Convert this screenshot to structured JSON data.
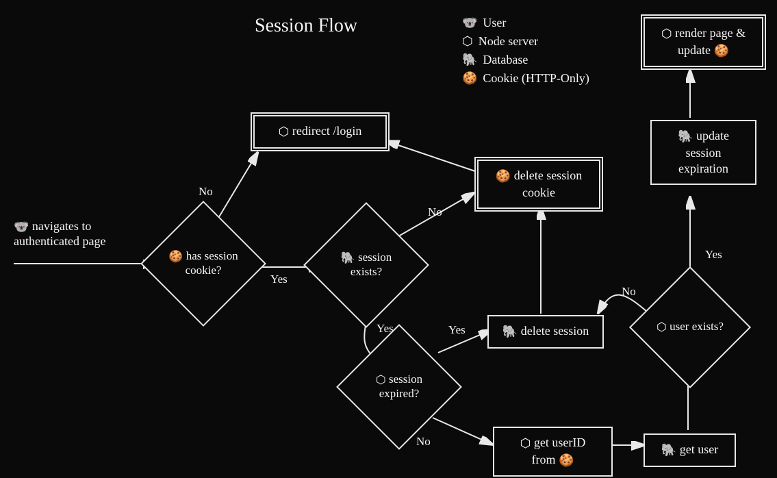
{
  "title": "Session Flow",
  "legend": {
    "user": "User",
    "node": "Node server",
    "db": "Database",
    "cookie": "Cookie (HTTP-Only)"
  },
  "nodes": {
    "start": "navigates to authenticated page",
    "has_cookie": "has session cookie?",
    "redirect": "redirect /login",
    "session_exists": "session exists?",
    "delete_cookie": "delete session cookie",
    "session_expired": "session expired?",
    "delete_session": "delete session",
    "get_userid": "get userID from",
    "get_user": "get user",
    "user_exists": "user exists?",
    "update_exp": "update session expiration",
    "render": "render page & update"
  },
  "edges": {
    "yes": "Yes",
    "no": "No"
  },
  "icons": {
    "user": "🐨",
    "node_glyph": "⬡",
    "db": "🐘",
    "cookie": "🍪"
  }
}
